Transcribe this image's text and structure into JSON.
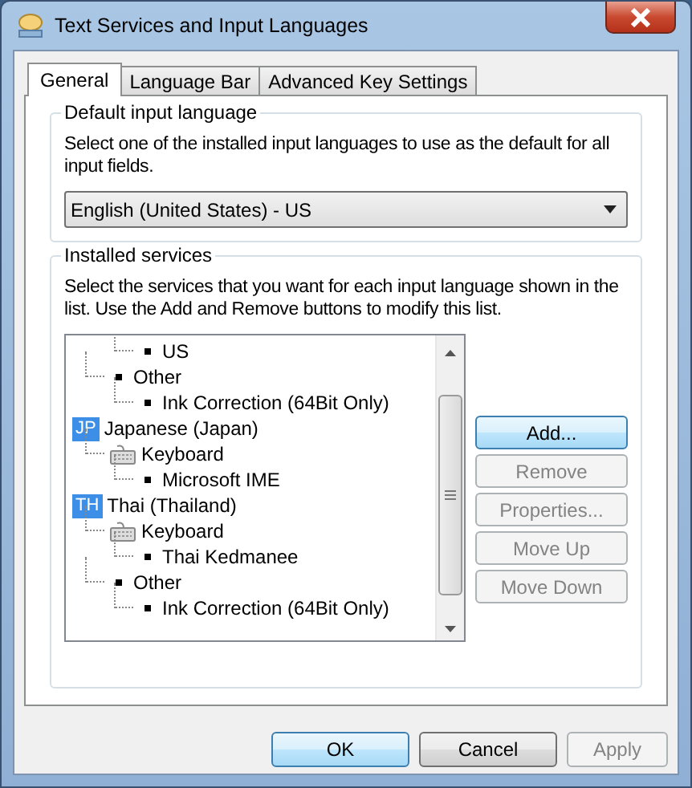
{
  "window": {
    "title": "Text Services and Input Languages"
  },
  "tabs": [
    {
      "label": "General",
      "selected": true
    },
    {
      "label": "Language Bar",
      "selected": false
    },
    {
      "label": "Advanced Key Settings",
      "selected": false
    }
  ],
  "default_language": {
    "title": "Default input language",
    "description": "Select one of the installed input languages to use as the default for all input fields.",
    "value": "English (United States) - US"
  },
  "installed_services": {
    "title": "Installed services",
    "description": "Select the services that you want for each input language shown in the list. Use the Add and Remove buttons to modify this list.",
    "tree": [
      {
        "kind": "hidden",
        "children": [
          {
            "kind": "hidden",
            "children": [
              {
                "kind": "service",
                "label": "US"
              }
            ]
          },
          {
            "kind": "group",
            "label": "Other",
            "children": [
              {
                "kind": "service",
                "label": "Ink Correction (64Bit Only)"
              }
            ]
          }
        ]
      },
      {
        "kind": "language",
        "badge": "JP",
        "label": "Japanese (Japan)",
        "children": [
          {
            "kind": "keyboard",
            "label": "Keyboard",
            "children": [
              {
                "kind": "service",
                "label": "Microsoft IME"
              }
            ]
          }
        ]
      },
      {
        "kind": "language",
        "badge": "TH",
        "label": "Thai (Thailand)",
        "children": [
          {
            "kind": "keyboard",
            "label": "Keyboard",
            "children": [
              {
                "kind": "service",
                "label": "Thai Kedmanee"
              }
            ]
          },
          {
            "kind": "group",
            "label": "Other",
            "children": [
              {
                "kind": "service",
                "label": "Ink Correction (64Bit Only)"
              }
            ]
          }
        ]
      }
    ],
    "buttons": [
      {
        "label": "Add...",
        "disabled": false,
        "focused": true
      },
      {
        "label": "Remove",
        "disabled": true,
        "focused": false
      },
      {
        "label": "Properties...",
        "disabled": true,
        "focused": false
      },
      {
        "label": "Move Up",
        "disabled": true,
        "focused": false
      },
      {
        "label": "Move Down",
        "disabled": true,
        "focused": false
      }
    ]
  },
  "footer_buttons": [
    {
      "label": "OK",
      "disabled": false,
      "focused": true
    },
    {
      "label": "Cancel",
      "disabled": false,
      "focused": false
    },
    {
      "label": "Apply",
      "disabled": true,
      "focused": false
    }
  ]
}
